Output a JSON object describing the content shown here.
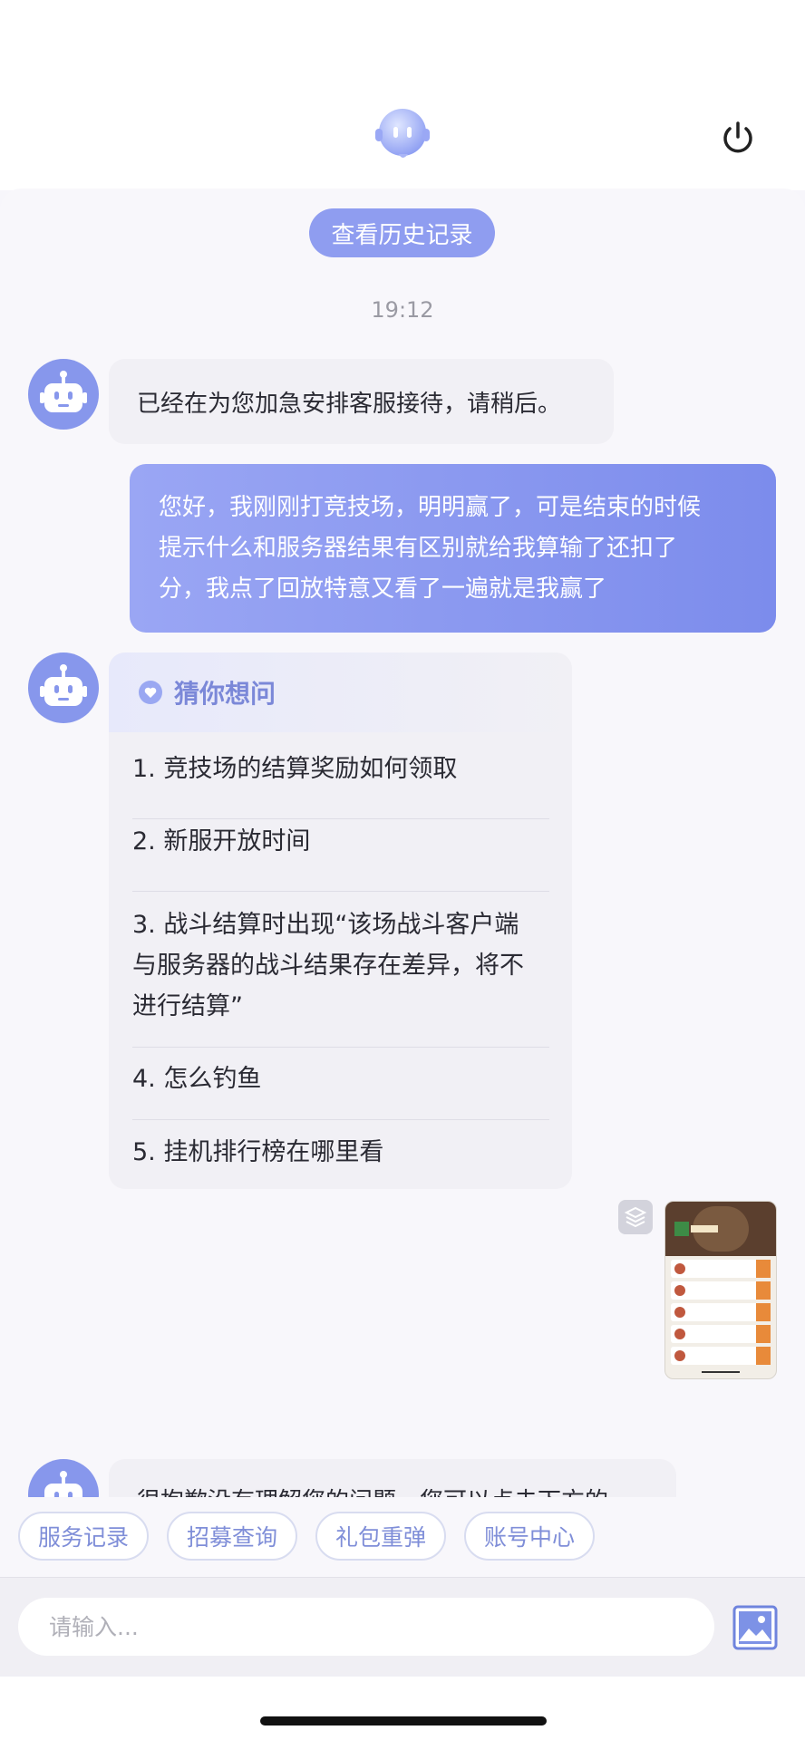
{
  "header": {
    "avatar_icon": "assistant-avatar-icon",
    "power_icon": "power-icon"
  },
  "chat": {
    "history_button": "查看历史记录",
    "timestamp": "19:12",
    "bot_message_1": "已经在为您加急安排客服接待，请稍后。",
    "user_message_lines": [
      "您好，我刚刚打竞技场，明明赢了，可是结束的时候",
      "提示什么和服务器结果有区别就给我算输了还扣了",
      "分，我点了回放特意又看了一遍就是我赢了"
    ],
    "suggestions": {
      "title": "猜你想问",
      "items": [
        "1. 竞技场的结算奖励如何领取",
        "2. 新服开放时间",
        "3. 战斗结算时出现“该场战斗客户端与服务器的战斗结果存在差异，将不进行结算”",
        "4. 怎么钓鱼",
        "5. 挂机排行榜在哪里看"
      ]
    },
    "bot_message_partial": "很抱歉没有理解您的问题，您可以点击下方的"
  },
  "quick_actions": [
    "服务记录",
    "招募查询",
    "礼包重弹",
    "账号中心"
  ],
  "input": {
    "placeholder": "请输入...",
    "value": ""
  },
  "colors": {
    "accent": "#8f9df0",
    "user_bubble": "#7c8cec",
    "bot_bubble": "#f1f0f5"
  }
}
